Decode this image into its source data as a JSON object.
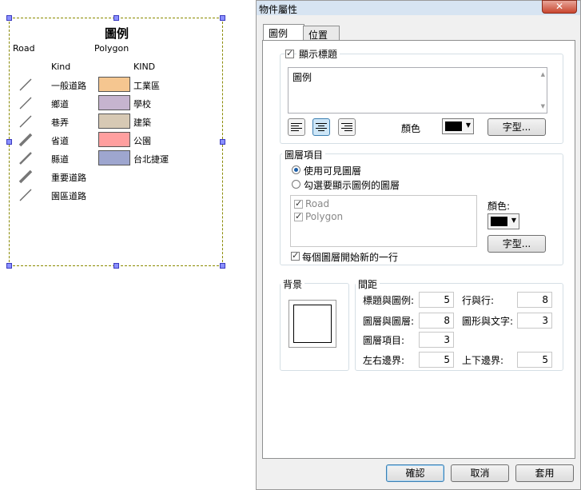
{
  "legend": {
    "title": "圖例",
    "layers": [
      {
        "name": "Road",
        "field": "Kind",
        "items": [
          {
            "label": "一般道路",
            "line_width": 1
          },
          {
            "label": "鄉道",
            "line_width": 1
          },
          {
            "label": "巷弄",
            "line_width": 1
          },
          {
            "label": "省道",
            "line_width": 3
          },
          {
            "label": "縣道",
            "line_width": 2
          },
          {
            "label": "重要道路",
            "line_width": 3
          },
          {
            "label": "園區道路",
            "line_width": 1
          }
        ]
      },
      {
        "name": "Polygon",
        "field": "KIND",
        "items": [
          {
            "label": "工業區",
            "color": "#f5c690"
          },
          {
            "label": "學校",
            "color": "#c6b4cf"
          },
          {
            "label": "建築",
            "color": "#d7c9b4"
          },
          {
            "label": "公園",
            "color": "#ff9f9f"
          },
          {
            "label": "台北捷運",
            "color": "#9ea6cf"
          }
        ]
      }
    ]
  },
  "dialog": {
    "title": "物件屬性",
    "close": "✕",
    "tabs": [
      "圖例",
      "位置"
    ],
    "active_tab": "圖例",
    "title_section": {
      "show_title_label": "顯示標題",
      "show_title_checked": true,
      "title_value": "圖例",
      "color_label": "顏色",
      "color": "#000000",
      "font_button": "字型..."
    },
    "layer_section": {
      "group_title": "圖層項目",
      "option_visible": "使用可見圖層",
      "option_checked": "勾選要顯示圖例的圖層",
      "selected_option": "visible",
      "layers": [
        {
          "name": "Road",
          "checked": true
        },
        {
          "name": "Polygon",
          "checked": true
        }
      ],
      "color_label": "顏色:",
      "color": "#000000",
      "font_button": "字型...",
      "new_line_label": "每個圖層開始新的一行",
      "new_line_checked": true
    },
    "background": {
      "label": "背景"
    },
    "spacing": {
      "label": "間距",
      "title_to_legend": {
        "label": "標題與圖例:",
        "value": "5"
      },
      "row_to_row": {
        "label": "行與行:",
        "value": "8"
      },
      "layer_to_layer": {
        "label": "圖層與圖層:",
        "value": "8"
      },
      "shape_to_text": {
        "label": "圖形與文字:",
        "value": "3"
      },
      "layer_item": {
        "label": "圖層項目:",
        "value": "3"
      },
      "left_right": {
        "label": "左右邊界:",
        "value": "5"
      },
      "top_bottom": {
        "label": "上下邊界:",
        "value": "5"
      }
    },
    "buttons": {
      "ok": "確認",
      "cancel": "取消",
      "apply": "套用"
    }
  }
}
